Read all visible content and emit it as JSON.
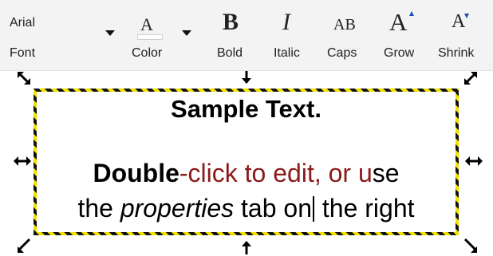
{
  "toolbar": {
    "font": {
      "value": "Arial",
      "label": "Font"
    },
    "color": {
      "glyph": "A",
      "label": "Color",
      "swatch": "#ffffff"
    },
    "bold": {
      "glyph": "B",
      "label": "Bold"
    },
    "italic": {
      "glyph": "I",
      "label": "Italic"
    },
    "caps": {
      "glyph": "AB",
      "label": "Caps"
    },
    "grow": {
      "glyph": "A",
      "label": "Grow",
      "icon": "grow-font-icon"
    },
    "shrink": {
      "glyph": "A",
      "label": "Shrink",
      "icon": "shrink-font-icon"
    }
  },
  "textbox": {
    "title": "Sample Text.",
    "line2": {
      "bold": "Double",
      "dash": "-",
      "red1": "click to edit, or u",
      "rest": "se"
    },
    "line3": {
      "before": "the ",
      "italic": "properties",
      "middle": " tab on",
      "after": " the right"
    },
    "border_colors": [
      "#111111",
      "#f2e100"
    ],
    "accent_red": "#8b1a1a"
  },
  "handles": {
    "resize_nw": "resize-nw-icon",
    "resize_n": "resize-n-icon",
    "resize_ne": "resize-ne-icon",
    "resize_w": "resize-w-icon",
    "resize_e": "resize-e-icon",
    "resize_sw": "resize-sw-icon",
    "resize_s": "resize-s-icon",
    "resize_se": "resize-se-icon"
  }
}
